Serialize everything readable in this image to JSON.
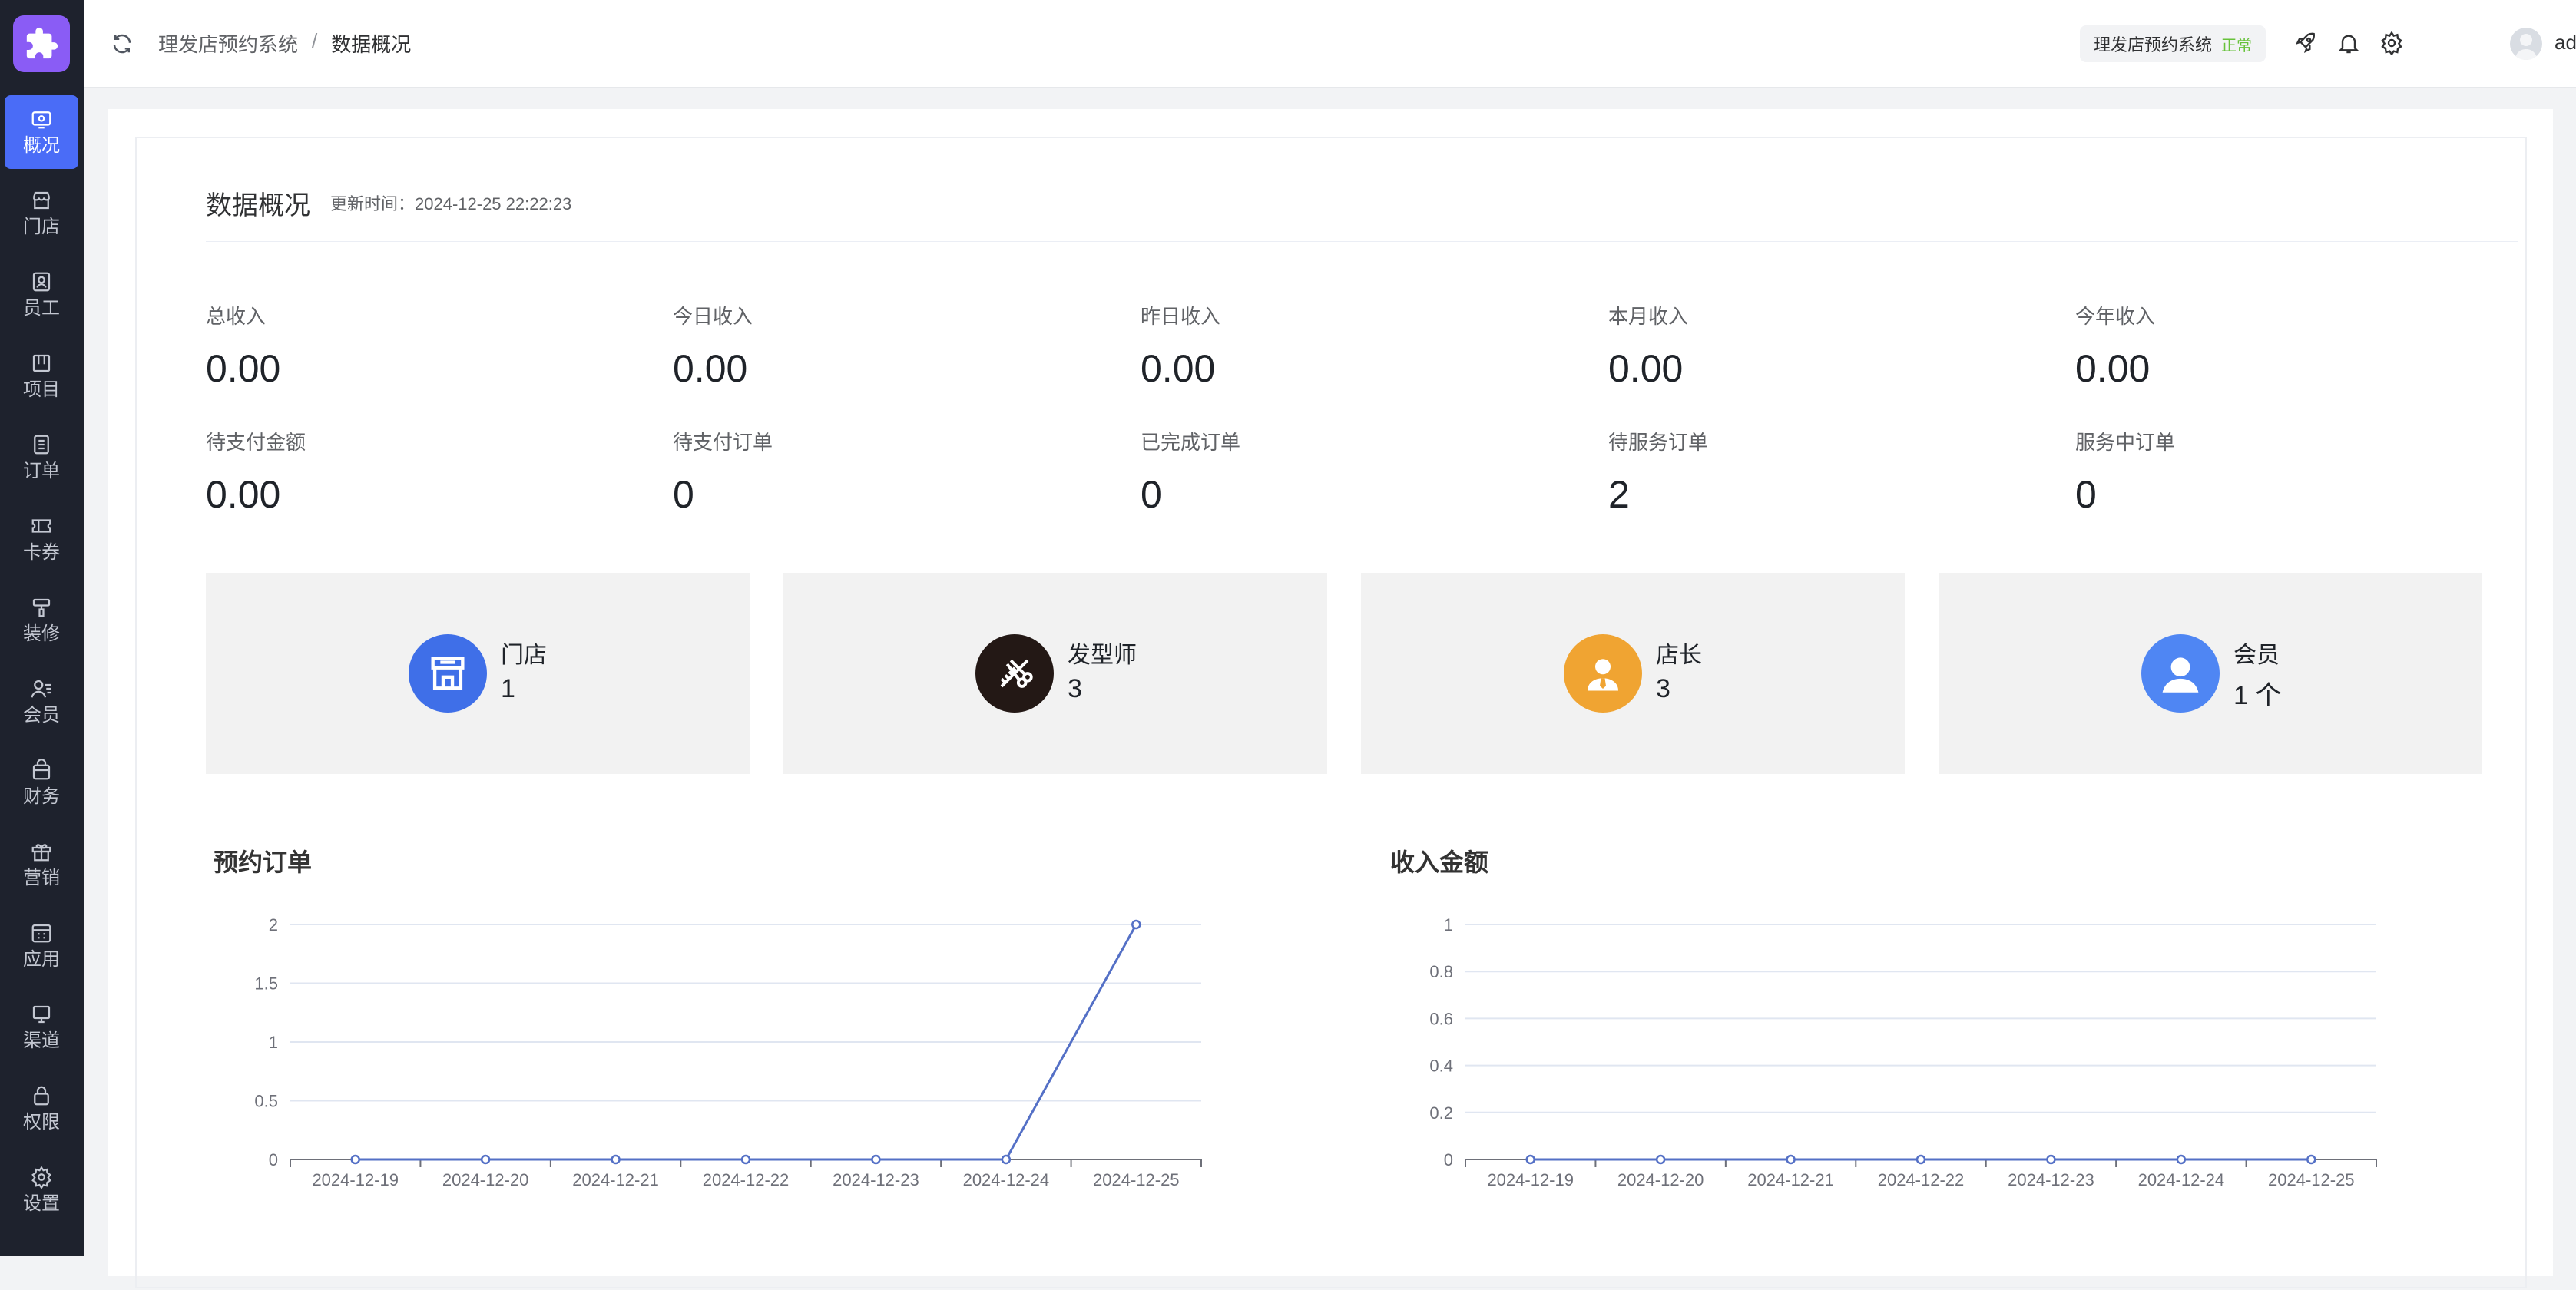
{
  "sidebar": {
    "items": [
      {
        "label": "概况",
        "icon": "dashboard-icon",
        "active": true
      },
      {
        "label": "门店",
        "icon": "store-icon"
      },
      {
        "label": "员工",
        "icon": "staff-icon"
      },
      {
        "label": "项目",
        "icon": "project-icon"
      },
      {
        "label": "订单",
        "icon": "order-icon"
      },
      {
        "label": "卡券",
        "icon": "coupon-icon"
      },
      {
        "label": "装修",
        "icon": "decoration-icon"
      },
      {
        "label": "会员",
        "icon": "member-icon"
      },
      {
        "label": "财务",
        "icon": "finance-icon"
      },
      {
        "label": "营销",
        "icon": "gift-icon"
      },
      {
        "label": "应用",
        "icon": "apps-icon"
      },
      {
        "label": "渠道",
        "icon": "channel-icon"
      },
      {
        "label": "权限",
        "icon": "lock-icon"
      },
      {
        "label": "设置",
        "icon": "settings-icon"
      }
    ]
  },
  "header": {
    "breadcrumb": [
      "理发店预约系统",
      "数据概况"
    ],
    "breadcrumb_sep": "/",
    "system_name": "理发店预约系统",
    "system_status": "正常",
    "username": "admin"
  },
  "overview": {
    "title": "数据概况",
    "updated": "更新时间：2024-12-25 22:22:23",
    "stats": [
      {
        "label": "总收入",
        "value": "0.00"
      },
      {
        "label": "今日收入",
        "value": "0.00"
      },
      {
        "label": "昨日收入",
        "value": "0.00"
      },
      {
        "label": "本月收入",
        "value": "0.00"
      },
      {
        "label": "今年收入",
        "value": "0.00"
      },
      {
        "label": "待支付金额",
        "value": "0.00"
      },
      {
        "label": "待支付订单",
        "value": "0"
      },
      {
        "label": "已完成订单",
        "value": "0"
      },
      {
        "label": "待服务订单",
        "value": "2"
      },
      {
        "label": "服务中订单",
        "value": "0"
      }
    ],
    "tiles": [
      {
        "label": "门店",
        "value": "1",
        "icon": "store-icon",
        "color": "#3f6fe8"
      },
      {
        "label": "发型师",
        "value": "3",
        "icon": "scissors-comb-icon",
        "color": "#231815"
      },
      {
        "label": "店长",
        "value": "3",
        "icon": "manager-icon",
        "color": "#f0a432"
      },
      {
        "label": "会员",
        "value": "1 个",
        "icon": "user-icon",
        "color": "#4f86f3"
      }
    ]
  },
  "chart_data": [
    {
      "type": "line",
      "title": "预约订单",
      "x": [
        "2024-12-19",
        "2024-12-20",
        "2024-12-21",
        "2024-12-22",
        "2024-12-23",
        "2024-12-24",
        "2024-12-25"
      ],
      "values": [
        0,
        0,
        0,
        0,
        0,
        0,
        2
      ],
      "ylim": [
        0,
        2
      ],
      "yticks": [
        "0",
        "0.5",
        "1",
        "1.5",
        "2"
      ],
      "grid": true,
      "color": "#5470c6"
    },
    {
      "type": "line",
      "title": "收入金额",
      "x": [
        "2024-12-19",
        "2024-12-20",
        "2024-12-21",
        "2024-12-22",
        "2024-12-23",
        "2024-12-24",
        "2024-12-25"
      ],
      "values": [
        0,
        0,
        0,
        0,
        0,
        0,
        0
      ],
      "ylim": [
        0,
        1
      ],
      "yticks": [
        "0",
        "0.2",
        "0.4",
        "0.6",
        "0.8",
        "1"
      ],
      "grid": true,
      "color": "#5470c6"
    }
  ]
}
